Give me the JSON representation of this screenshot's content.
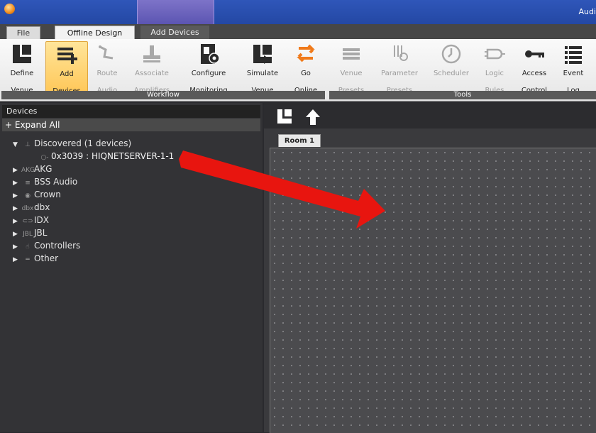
{
  "app": {
    "title": "Audi"
  },
  "tabs": [
    "File",
    "Offline Design",
    "Add Devices"
  ],
  "ribbon": {
    "workflow": [
      {
        "label_line1": "Define",
        "label_line2": "Venue",
        "icon": "define-venue-icon"
      },
      {
        "label_line1": "Add",
        "label_line2": "Devices",
        "icon": "add-devices-icon"
      },
      {
        "label_line1": "Route",
        "label_line2": "Audio",
        "icon": "route-audio-icon"
      },
      {
        "label_line1": "Associate",
        "label_line2": "Amplifiers",
        "icon": "associate-amplifiers-icon"
      },
      {
        "label_line1": "Configure",
        "label_line2": "Monitoring",
        "icon": "configure-monitoring-icon"
      },
      {
        "label_line1": "Simulate",
        "label_line2": "Venue",
        "icon": "simulate-venue-icon"
      },
      {
        "label_line1": "Go",
        "label_line2": "Online",
        "icon": "go-online-icon"
      }
    ],
    "tools": [
      {
        "label_line1": "Venue",
        "label_line2": "Presets",
        "icon": "venue-presets-icon"
      },
      {
        "label_line1": "Parameter",
        "label_line2": "Presets",
        "icon": "parameter-presets-icon"
      },
      {
        "label_line1": "Scheduler",
        "label_line2": "",
        "icon": "scheduler-icon"
      },
      {
        "label_line1": "Logic",
        "label_line2": "Rules",
        "icon": "logic-rules-icon"
      },
      {
        "label_line1": "Access",
        "label_line2": "Control",
        "icon": "access-control-icon"
      },
      {
        "label_line1": "Event",
        "label_line2": "Log",
        "icon": "event-log-icon"
      }
    ],
    "group_workflow": "Workflow",
    "group_tools": "Tools"
  },
  "devices_panel": {
    "title": "Devices",
    "expand_all": "+ Expand All",
    "tree": [
      {
        "label": "Discovered (1 devices)",
        "expanded": true
      },
      {
        "label": "0x3039 : HIQNETSERVER-1-1",
        "child": true
      },
      {
        "label": "AKG",
        "icon_text": "AKG"
      },
      {
        "label": "BSS Audio"
      },
      {
        "label": "Crown"
      },
      {
        "label": "dbx",
        "icon_text": "dbx"
      },
      {
        "label": "IDX"
      },
      {
        "label": "JBL",
        "icon_text": "JBL"
      },
      {
        "label": "Controllers"
      },
      {
        "label": "Other"
      }
    ]
  },
  "canvas": {
    "room_tab": "Room 1"
  },
  "colors": {
    "title_bar": "#2f56b9",
    "highlight": "#ffc85a",
    "annotation_arrow": "#e8150f"
  }
}
